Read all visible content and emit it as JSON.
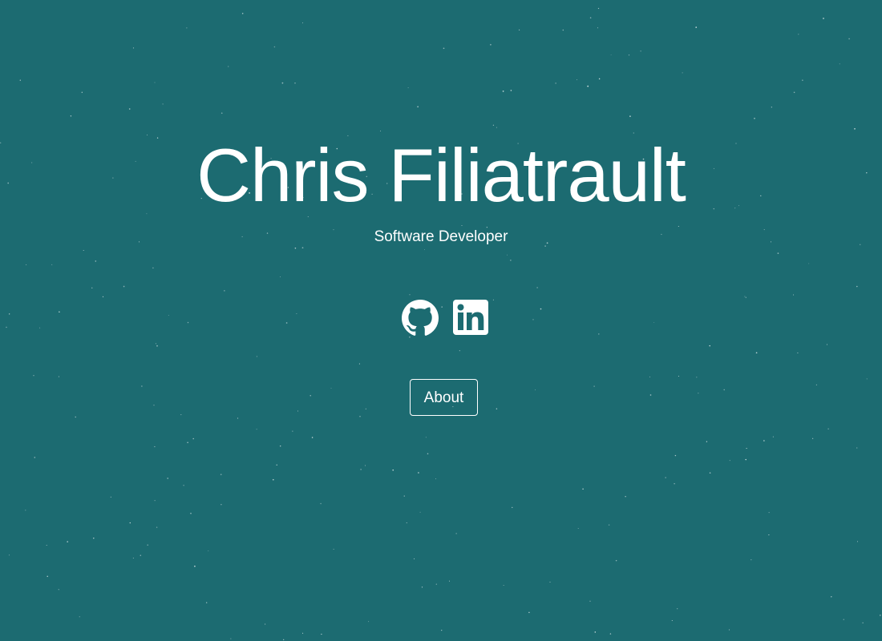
{
  "hero": {
    "name": "Chris Filiatrault",
    "tagline": "Software Developer"
  },
  "social": {
    "github_icon": "github-icon",
    "linkedin_icon": "linkedin-icon"
  },
  "about_button": {
    "label": "About"
  },
  "colors": {
    "background": "#1c6b71",
    "text": "#ffffff"
  }
}
